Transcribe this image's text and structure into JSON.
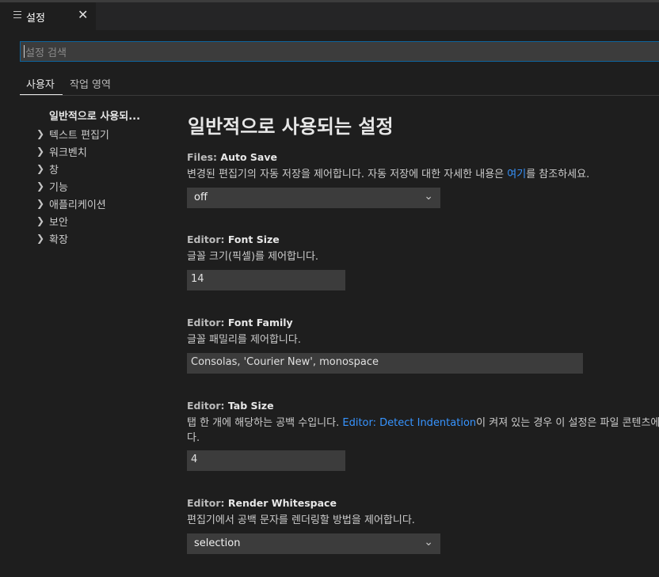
{
  "tab": {
    "label": "설정",
    "close": "✕"
  },
  "search": {
    "placeholder": "설정 검색"
  },
  "scopes": [
    "사용자",
    "작업 영역"
  ],
  "toc": {
    "head": "일반적으로 사용되...",
    "items": [
      "텍스트 편집기",
      "워크벤치",
      "창",
      "기능",
      "애플리케이션",
      "보안",
      "확장"
    ]
  },
  "main": {
    "title": "일반적으로 사용되는 설정",
    "settings": [
      {
        "category": "Files: ",
        "name": "Auto Save",
        "desc_before": "변경된 편집기의 자동 저장을 제어합니다. 자동 저장에 대한 자세한 내용은 ",
        "desc_link": "여기",
        "desc_after": "를 참조하세요.",
        "value": "off"
      },
      {
        "category": "Editor: ",
        "name": "Font Size",
        "desc": "글꼴 크기(픽셀)를 제어합니다.",
        "value": "14"
      },
      {
        "category": "Editor: ",
        "name": "Font Family",
        "desc": "글꼴 패밀리를 제어합니다.",
        "value": "Consolas, 'Courier New', monospace"
      },
      {
        "category": "Editor: ",
        "name": "Tab Size",
        "desc_before": "탭 한 개에 해당하는 공백 수입니다. ",
        "desc_link": "Editor: Detect Indentation",
        "desc_after": "이 켜져 있는 경우 이 설정은 파일 콘텐츠에",
        "desc_line2": "다.",
        "value": "4"
      },
      {
        "category": "Editor: ",
        "name": "Render Whitespace",
        "desc": "편집기에서 공백 문자를 렌더링할 방법을 제어합니다.",
        "value": "selection"
      }
    ]
  },
  "colors": {
    "accent": "#0e639c",
    "link": "#3794ff",
    "background": "#1e1e1e"
  }
}
